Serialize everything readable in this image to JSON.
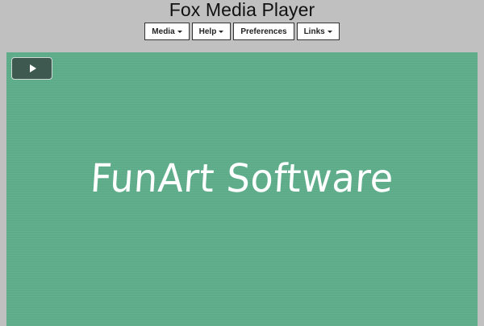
{
  "app": {
    "title": "Fox Media Player"
  },
  "menu": {
    "items": [
      {
        "label": "Media",
        "has_dropdown": true
      },
      {
        "label": "Help",
        "has_dropdown": true
      },
      {
        "label": "Preferences",
        "has_dropdown": false
      },
      {
        "label": "Links",
        "has_dropdown": true
      }
    ]
  },
  "player": {
    "play_icon": "play-icon",
    "caption": "FunArt Software"
  },
  "colors": {
    "page_background": "#c0c0c0",
    "video_background": "#5fae8c",
    "play_button_background": "#3e5a50",
    "caption_color": "#ffffff"
  }
}
